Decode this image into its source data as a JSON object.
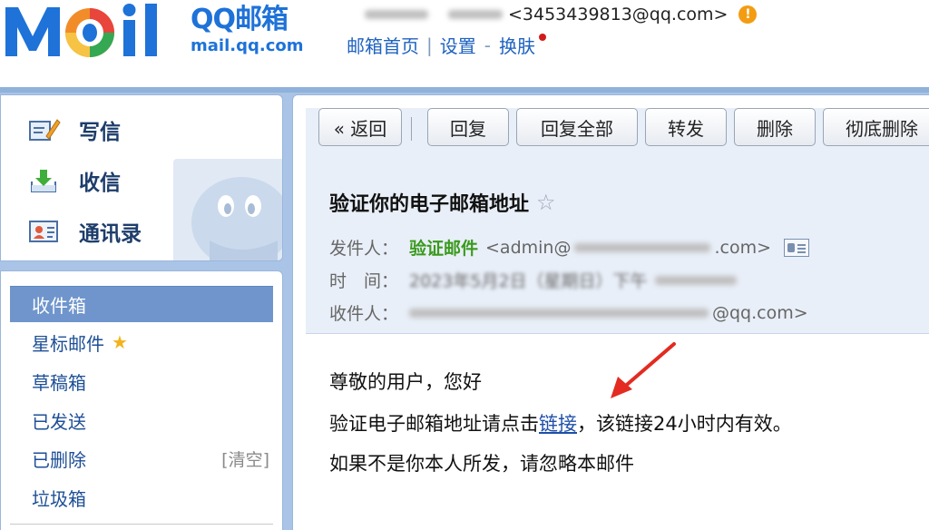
{
  "header": {
    "logo_text": "Moil",
    "product_name": "QQ邮箱",
    "product_domain": "mail.qq.com",
    "account_email": "<3453439813@qq.com>",
    "nav": {
      "home": "邮箱首页",
      "settings": "设置",
      "skin": "换肤"
    }
  },
  "sidebar": {
    "quick_actions": [
      {
        "label": "写信",
        "icon": "compose-icon"
      },
      {
        "label": "收信",
        "icon": "inbox-download-icon"
      },
      {
        "label": "通讯录",
        "icon": "contacts-icon"
      }
    ],
    "folders": [
      {
        "label": "收件箱",
        "active": true
      },
      {
        "label": "星标邮件",
        "star": true
      },
      {
        "label": "草稿箱"
      },
      {
        "label": "已发送"
      },
      {
        "label": "已删除",
        "extra": "[清空]"
      },
      {
        "label": "垃圾箱"
      }
    ]
  },
  "toolbar": {
    "back": "« 返回",
    "reply": "回复",
    "reply_all": "回复全部",
    "forward": "转发",
    "delete": "删除",
    "delete_permanent": "彻底删除"
  },
  "mail": {
    "subject": "验证你的电子邮箱地址",
    "from_label": "发件人：",
    "from_name": "验证邮件",
    "from_address": "<admin@",
    "from_address_end": ".com>",
    "time_label": "时　间：",
    "time_value": "2023年5月2日（星期日）下午",
    "to_label": "收件人：",
    "to_address_end": "@qq.com>",
    "body": {
      "greeting": "尊敬的用户，您好",
      "line1_before": "验证电子邮箱地址请点击",
      "link": "链接",
      "line1_after": "，该链接24小时内有效。",
      "line2": "如果不是你本人所发，请忽略本邮件"
    }
  },
  "colors": {
    "brand_blue": "#1e72d8",
    "frame_blue": "#a9c4e6",
    "active_folder": "#6f95cc",
    "sender_green": "#3a9a1e",
    "annotation_red": "#e32b21"
  }
}
